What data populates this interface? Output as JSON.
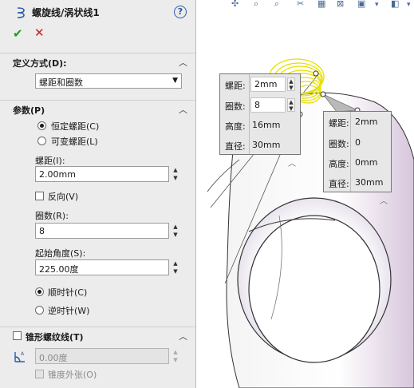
{
  "panel": {
    "title": "螺旋线/涡状线1",
    "help_icon": "?",
    "ok_icon": "✔",
    "cancel_icon": "✕",
    "define_section": {
      "label": "定义方式(D):",
      "selected": "螺距和圈数"
    },
    "params_section": {
      "label": "参数(P)",
      "constant_pitch": "恒定螺距(C)",
      "variable_pitch": "可变螺距(L)",
      "pitch_label": "螺距(I):",
      "pitch_value": "2.00mm",
      "reverse_label": "反向(V)",
      "revolutions_label": "圈数(R):",
      "revolutions_value": "8",
      "start_angle_label": "起始角度(S):",
      "start_angle_value": "225.00度",
      "clockwise": "顺时针(C)",
      "counterclockwise": "逆时针(W)"
    },
    "taper_section": {
      "label": "锥形螺纹线(T)",
      "angle_value": "0.00度",
      "taper_outward": "锥度外张(O)"
    }
  },
  "viewport": {
    "popup_left": {
      "rows": [
        {
          "key": "螺距:",
          "value": "2mm"
        },
        {
          "key": "圈数:",
          "value": "8"
        },
        {
          "key": "高度:",
          "value": "16mm"
        },
        {
          "key": "直径:",
          "value": "30mm"
        }
      ]
    },
    "popup_right": {
      "rows": [
        {
          "key": "螺距:",
          "value": "2mm"
        },
        {
          "key": "圈数:",
          "value": "0"
        },
        {
          "key": "高度:",
          "value": "0mm"
        },
        {
          "key": "直径:",
          "value": "30mm"
        }
      ]
    }
  },
  "colors": {
    "helix": "#e8e000",
    "ok": "#1b9e1b",
    "cancel": "#d11a1a",
    "model_shade": "#d7c6dc"
  }
}
